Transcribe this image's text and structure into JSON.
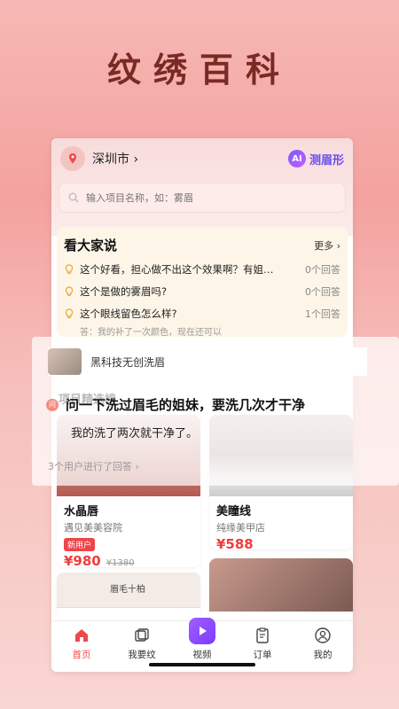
{
  "headline": "纹绣百科",
  "header": {
    "city": "深圳市 ›",
    "ai_label": "测眉形",
    "ai_badge_text": "AI"
  },
  "search": {
    "placeholder": "输入项目名称，如：雾眉"
  },
  "qa_section": {
    "title": "看大家说",
    "more_label": "更多 ›",
    "items": [
      {
        "question": "这个好看，担心做不出这个效果啊？有姐…",
        "count": "0个回答"
      },
      {
        "question": "这个是做的雾眉吗?",
        "count": "0个回答"
      },
      {
        "question": "这个眼线留色怎么样?",
        "count": "1个回答"
      }
    ],
    "answer_preview": "答：我的补了一次颜色，现在还可以"
  },
  "overlay": {
    "item_label": "黑科技无创洗眉",
    "section_title": "项目精选榜",
    "ask_badge": "问",
    "question": "问一下洗过眉毛的姐妹，要洗几次才干净",
    "answer": "我的洗了两次就干净了。",
    "meta": "3个用户进行了回答 ›"
  },
  "products": [
    {
      "name": "水晶唇",
      "shop": "遇见美美容院",
      "tag": "新用户",
      "price": "¥980",
      "original_price": "¥1380"
    },
    {
      "name": "美瞳线",
      "shop": "纯缘美甲店",
      "price": "¥588"
    }
  ],
  "brow_card_label": "眉毛十柏",
  "tabbar": {
    "items": [
      {
        "label": "首页",
        "icon": "home-icon",
        "active": true
      },
      {
        "label": "我要纹",
        "icon": "stack-icon",
        "active": false
      },
      {
        "label": "视频",
        "icon": "play-icon",
        "active": false
      },
      {
        "label": "订单",
        "icon": "clipboard-icon",
        "active": false
      },
      {
        "label": "我的",
        "icon": "user-icon",
        "active": false
      }
    ]
  },
  "colors": {
    "accent": "#f04848",
    "background": "#f4a29f",
    "video_button": "#8b4cff"
  }
}
